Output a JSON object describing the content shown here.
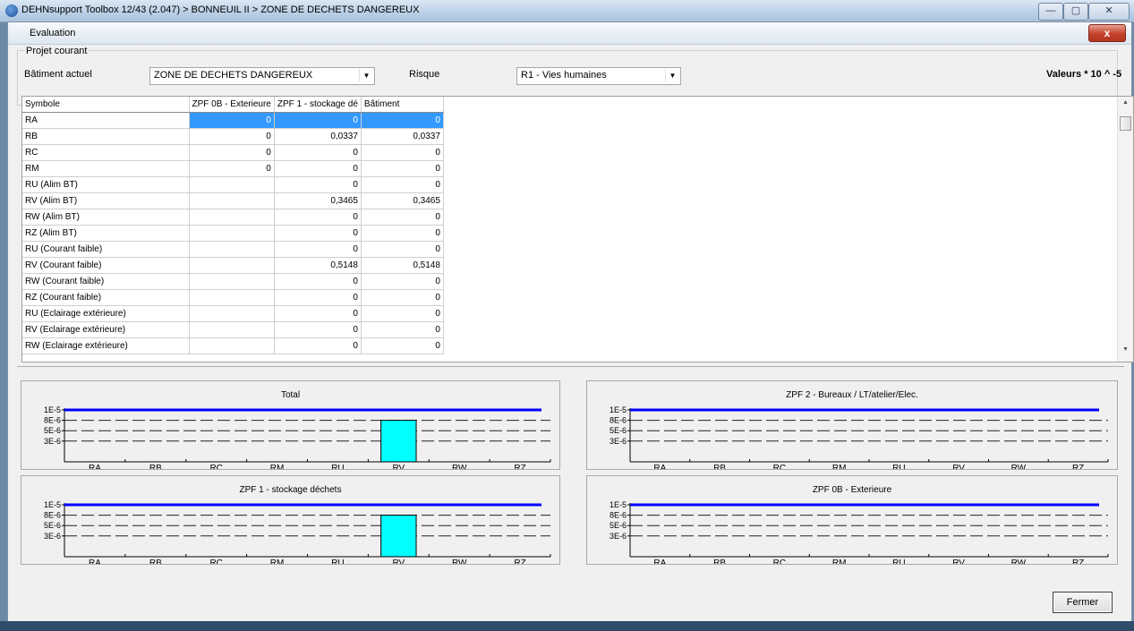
{
  "app": {
    "title": "DEHNsupport Toolbox 12/43 (2.047) > BONNEUIL II > ZONE DE DECHETS DANGEREUX",
    "minimize": "—",
    "maximize": "▢",
    "close": "✕"
  },
  "dialog": {
    "title": "Evaluation",
    "close": "x",
    "group_label": "Projet courant",
    "building_label": "Bâtiment actuel",
    "building_value": "ZONE DE DECHETS DANGEREUX",
    "risk_label": "Risque",
    "risk_value": "R1 - Vies humaines",
    "values_scale": "Valeurs * 10 ^ -5",
    "close_button": "Fermer"
  },
  "grid": {
    "headers": [
      "Symbole",
      "ZPF 0B - Exterieure",
      "ZPF 1 - stockage dé",
      "Bâtiment"
    ],
    "rows": [
      [
        "RA",
        "0",
        "0",
        "0"
      ],
      [
        "RB",
        "0",
        "0,0337",
        "0,0337"
      ],
      [
        "RC",
        "0",
        "0",
        "0"
      ],
      [
        "RM",
        "0",
        "0",
        "0"
      ],
      [
        "RU (Alim BT)",
        "",
        "0",
        "0"
      ],
      [
        "RV (Alim BT)",
        "",
        "0,3465",
        "0,3465"
      ],
      [
        "RW (Alim BT)",
        "",
        "0",
        "0"
      ],
      [
        "RZ (Alim BT)",
        "",
        "0",
        "0"
      ],
      [
        "RU (Courant faible)",
        "",
        "0",
        "0"
      ],
      [
        "RV (Courant faible)",
        "",
        "0,5148",
        "0,5148"
      ],
      [
        "RW (Courant faible)",
        "",
        "0",
        "0"
      ],
      [
        "RZ (Courant faible)",
        "",
        "0",
        "0"
      ],
      [
        "RU (Eclairage extérieure)",
        "",
        "0",
        "0"
      ],
      [
        "RV (Eclairage extérieure)",
        "",
        "0",
        "0"
      ],
      [
        "RW (Eclairage extérieure)",
        "",
        "0",
        "0"
      ]
    ]
  },
  "chart_data": [
    {
      "type": "bar",
      "title": "Total",
      "categories": [
        "RA",
        "RB",
        "RC",
        "RM",
        "RU",
        "RV",
        "RW",
        "RZ"
      ],
      "values": [
        0,
        0,
        0,
        0,
        0,
        8e-06,
        0,
        0
      ],
      "yticks": [
        "1E-5",
        "8E-6",
        "5E-6",
        "3E-6"
      ],
      "threshold": 1e-05,
      "ylim": [
        0,
        1e-05
      ],
      "bar_color": "#00ffff",
      "threshold_color": "#0000ff"
    },
    {
      "type": "bar",
      "title": "ZPF 2 - Bureaux / LT/atelier/Elec.",
      "categories": [
        "RA",
        "RB",
        "RC",
        "RM",
        "RU",
        "RV",
        "RW",
        "RZ"
      ],
      "values": [
        0,
        0,
        0,
        0,
        0,
        0,
        0,
        0
      ],
      "yticks": [
        "1E-5",
        "8E-6",
        "5E-6",
        "3E-6"
      ],
      "threshold": 1e-05,
      "ylim": [
        0,
        1e-05
      ],
      "bar_color": "#00ffff",
      "threshold_color": "#0000ff"
    },
    {
      "type": "bar",
      "title": "ZPF 1 - stockage déchets",
      "categories": [
        "RA",
        "RB",
        "RC",
        "RM",
        "RU",
        "RV",
        "RW",
        "RZ"
      ],
      "values": [
        0,
        0,
        0,
        0,
        0,
        8e-06,
        0,
        0
      ],
      "yticks": [
        "1E-5",
        "8E-6",
        "5E-6",
        "3E-6"
      ],
      "threshold": 1e-05,
      "ylim": [
        0,
        1e-05
      ],
      "bar_color": "#00ffff",
      "threshold_color": "#0000ff"
    },
    {
      "type": "bar",
      "title": "ZPF 0B - Exterieure",
      "categories": [
        "RA",
        "RB",
        "RC",
        "RM",
        "RU",
        "RV",
        "RW",
        "RZ"
      ],
      "values": [
        0,
        0,
        0,
        0,
        0,
        0,
        0,
        0
      ],
      "yticks": [
        "1E-5",
        "8E-6",
        "5E-6",
        "3E-6"
      ],
      "threshold": 1e-05,
      "ylim": [
        0,
        1e-05
      ],
      "bar_color": "#00ffff",
      "threshold_color": "#0000ff"
    }
  ]
}
